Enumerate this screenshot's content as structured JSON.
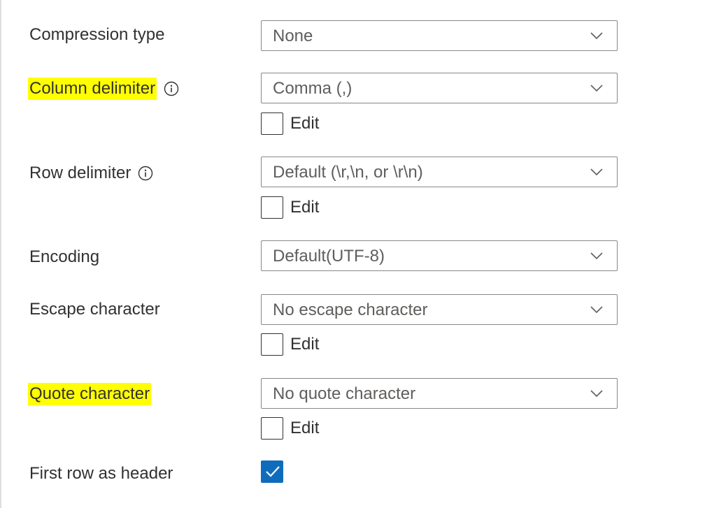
{
  "fields": {
    "compression": {
      "label": "Compression type",
      "value": "None"
    },
    "column_delimiter": {
      "label": "Column delimiter",
      "value": "Comma (,)",
      "edit_label": "Edit"
    },
    "row_delimiter": {
      "label": "Row delimiter",
      "value": "Default (\\r,\\n, or \\r\\n)",
      "edit_label": "Edit"
    },
    "encoding": {
      "label": "Encoding",
      "value": "Default(UTF-8)"
    },
    "escape_character": {
      "label": "Escape character",
      "value": "No escape character",
      "edit_label": "Edit"
    },
    "quote_character": {
      "label": "Quote character",
      "value": "No quote character",
      "edit_label": "Edit"
    },
    "first_row_header": {
      "label": "First row as header",
      "checked": true
    }
  },
  "colors": {
    "highlight": "#ffff00",
    "checkbox_accent": "#0f6cbd",
    "border": "#8a8886"
  },
  "icons": [
    "info-icon",
    "chevron-down-icon",
    "checkmark-icon"
  ]
}
